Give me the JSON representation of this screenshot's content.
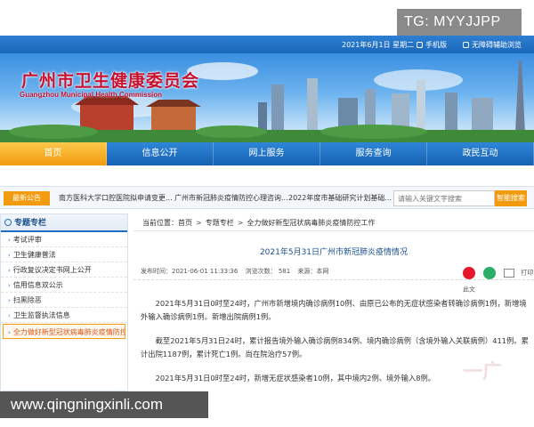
{
  "watermark": {
    "top": "TG: MYYJJPP",
    "bottom": "www.qingningxinli.com",
    "faint": "一广"
  },
  "topbar": {
    "date": "2021年6月1日  星期二",
    "mobile": "手机版",
    "accessibility": "无障碍辅助浏览"
  },
  "site": {
    "title": "广州市卫生健康委员会",
    "subtitle": "Guangzhou Municipal Health Commission"
  },
  "nav": {
    "items": [
      "首页",
      "信息公开",
      "网上服务",
      "服务查询",
      "政民互动"
    ]
  },
  "notice": {
    "label": "最新公告",
    "items": [
      "南方医科大学口腔医院拟申请变更...",
      "广州市新冠肺炎疫情防控心理咨询...",
      "2022年度市基础研究计划基础..."
    ],
    "search_placeholder": "请输入关键文字搜索",
    "search_button": "智能搜索"
  },
  "sidebar": {
    "title": "专题专栏",
    "items": [
      "考试评审",
      "卫生健康普法",
      "行政复议决定书网上公开",
      "信用信息双公示",
      "扫黑除恶",
      "卫生监督执法信息",
      "全力做好新型冠状病毒肺炎疫情防控工作"
    ]
  },
  "breadcrumb": {
    "prefix": "当前位置：",
    "items": [
      "首页",
      "专题专栏",
      "全力做好新型冠状病毒肺炎疫情防控工作"
    ]
  },
  "article": {
    "title": "2021年5月31日广州市新冠肺炎疫情情况",
    "publish_time": "发布时间：2021-06-01 11:33:36",
    "views": "浏览次数：  581",
    "source": "来源：本网",
    "print": "打印此文",
    "paragraphs": [
      "2021年5月31日0时至24时，广州市新增境内确诊病例10例、由原已公布的无症状感染者转确诊病例1例，新增境外输入确诊病例1例。新增出院病例1例。",
      "截至2021年5月31日24时，累计报告境外输入确诊病例834例、境内确诊病例（含境外输入关联病例）411例。累计出院1187例，累计死亡1例。尚在院治疗57例。",
      "2021年5月31日0时至24时，新增无症状感染者10例，其中境内2例、境外输入8例。"
    ]
  }
}
